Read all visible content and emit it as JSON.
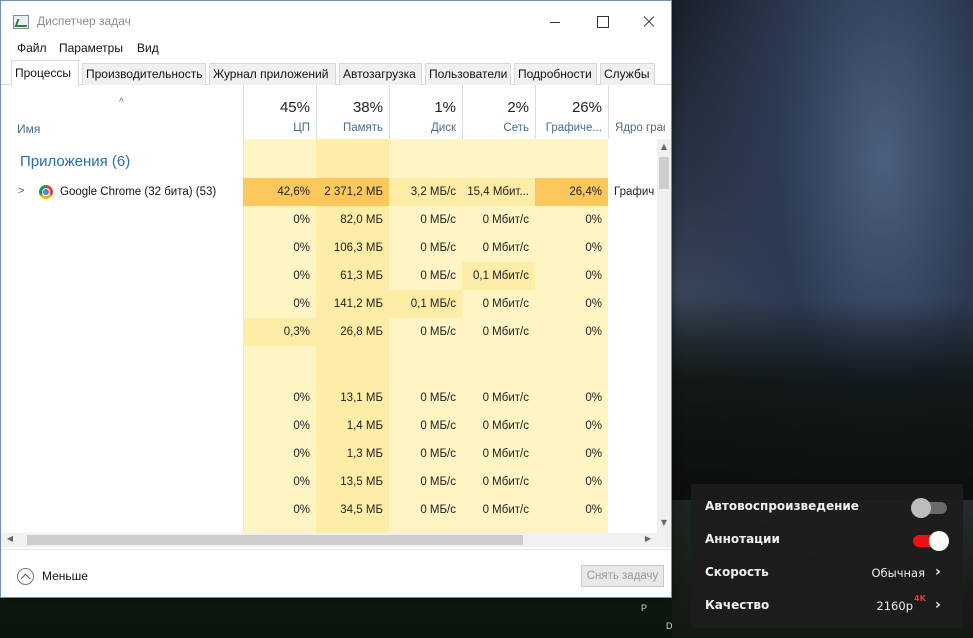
{
  "window": {
    "title": "Диспетчер задач",
    "menu": [
      "Файл",
      "Параметры",
      "Вид"
    ],
    "tabs": [
      "Процессы",
      "Производительность",
      "Журнал приложений",
      "Автозагрузка",
      "Пользователи",
      "Подробности",
      "Службы"
    ],
    "active_tab": "Процессы"
  },
  "header": {
    "sort_indicator": "^",
    "name_label": "Имя",
    "columns": [
      {
        "pct": "45%",
        "label": "ЦП"
      },
      {
        "pct": "38%",
        "label": "Память"
      },
      {
        "pct": "1%",
        "label": "Диск"
      },
      {
        "pct": "2%",
        "label": "Сеть"
      },
      {
        "pct": "26%",
        "label": "Графиче..."
      },
      {
        "pct": "",
        "label": "Ядро граф"
      }
    ]
  },
  "group": {
    "title": "Приложения (6)",
    "process": {
      "expander": ">",
      "name": "Google Chrome (32 бита) (53)",
      "cells": [
        "42,6%",
        "2 371,2 МБ",
        "3,2 МБ/с",
        "15,4 Мбит...",
        "26,4%",
        "Графич"
      ]
    }
  },
  "rows_a": [
    [
      "0%",
      "82,0 МБ",
      "0 МБ/с",
      "0 Мбит/с",
      "0%"
    ],
    [
      "0%",
      "106,3 МБ",
      "0 МБ/с",
      "0 Мбит/с",
      "0%"
    ],
    [
      "0%",
      "61,3 МБ",
      "0 МБ/с",
      "0,1 Мбит/с",
      "0%"
    ],
    [
      "0%",
      "141,2 МБ",
      "0,1 МБ/с",
      "0 Мбит/с",
      "0%"
    ],
    [
      "0,3%",
      "26,8 МБ",
      "0 МБ/с",
      "0 Мбит/с",
      "0%"
    ]
  ],
  "rows_b": [
    [
      "0%",
      "13,1 МБ",
      "0 МБ/с",
      "0 Мбит/с",
      "0%"
    ],
    [
      "0%",
      "1,4 МБ",
      "0 МБ/с",
      "0 Мбит/с",
      "0%"
    ],
    [
      "0%",
      "1,3 МБ",
      "0 МБ/с",
      "0 Мбит/с",
      "0%"
    ],
    [
      "0%",
      "13,5 МБ",
      "0 МБ/с",
      "0 Мбит/с",
      "0%"
    ],
    [
      "0%",
      "34,5 МБ",
      "0 МБ/с",
      "0 Мбит/с",
      "0%"
    ]
  ],
  "footer": {
    "less_label": "Меньше",
    "end_task_label": "Снять задачу"
  },
  "video_settings": {
    "autoplay_label": "Автовоспроизведение",
    "autoplay_on": false,
    "annotations_label": "Аннотации",
    "annotations_on": true,
    "speed_label": "Скорость",
    "speed_value": "Обычная",
    "quality_label": "Качество",
    "quality_value": "2160p",
    "quality_badge": "4K"
  },
  "desktop_letters": [
    "P",
    "D"
  ],
  "colors": {
    "heat_high": "#fcc75b",
    "heat_mid": "#fdeda7",
    "heat_low": "#fff4c4",
    "accent_blue": "#2a6ea8",
    "toggle_on": "#ee1111"
  }
}
